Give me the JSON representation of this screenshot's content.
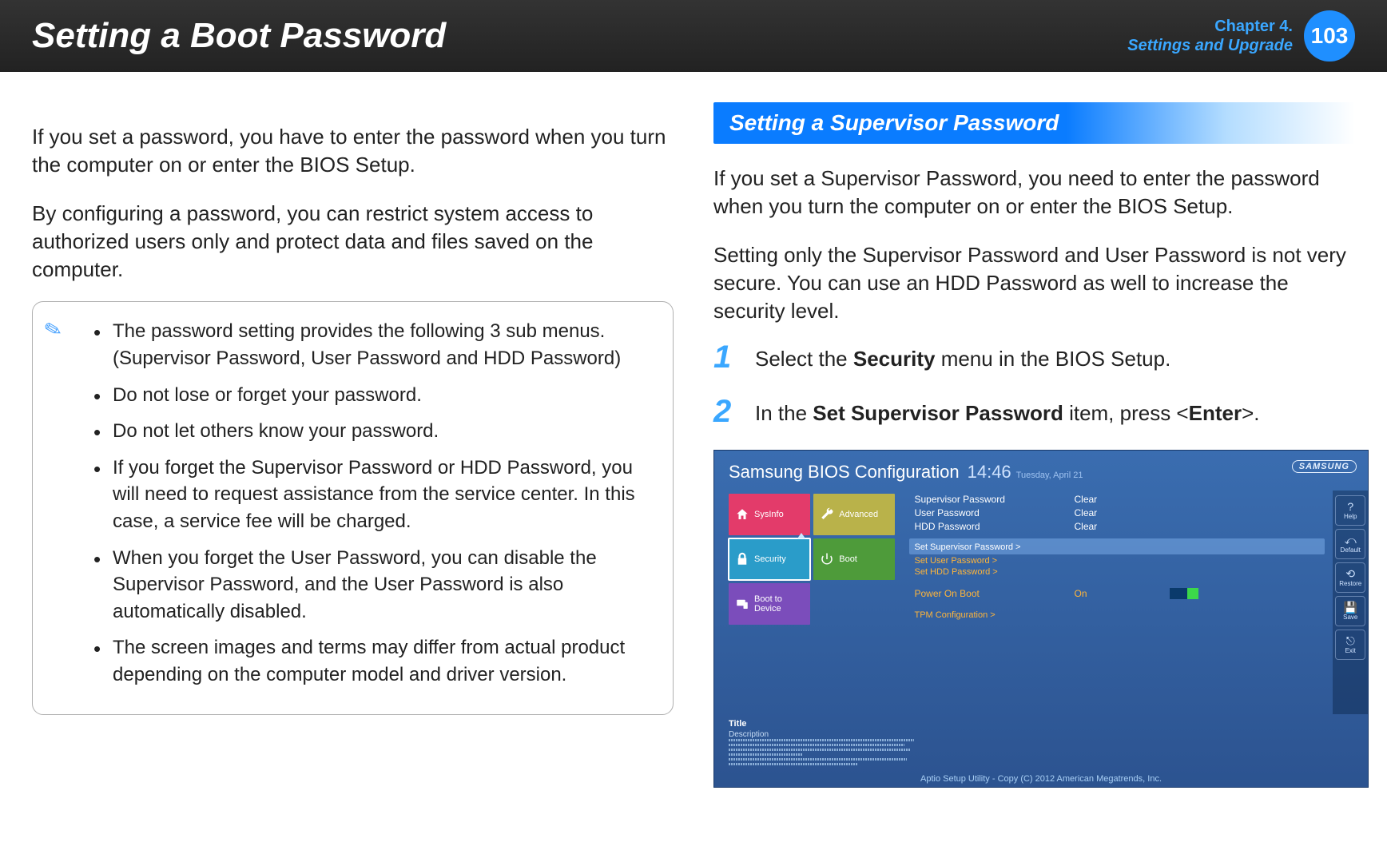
{
  "header": {
    "title": "Setting a Boot Password",
    "chapter_line1": "Chapter 4.",
    "chapter_line2": "Settings and Upgrade",
    "page_number": "103"
  },
  "left": {
    "p1": "If you set a password, you have to enter the password when you turn the computer on or enter the BIOS Setup.",
    "p2": "By configuring a password, you can restrict system access to authorized users only and protect data and files saved on the computer.",
    "notes": [
      "The password setting provides the following 3 sub menus. (Supervisor Password, User Password and HDD Password)",
      "Do not lose or forget your password.",
      "Do not let others know your password.",
      "If you forget the Supervisor Password or HDD Password, you will need to request assistance from the service center. In this case, a service fee will be charged.",
      "When you forget the User Password, you can disable the Supervisor Password, and the User Password is also automatically disabled.",
      "The screen images and terms may differ from actual product depending on the computer model and driver version."
    ]
  },
  "right": {
    "section_title": "Setting a Supervisor Password",
    "p1": "If you set a Supervisor Password, you need to enter the password when you turn the computer on or enter the BIOS Setup.",
    "p2": "Setting only the Supervisor Password and User Password is not very secure. You can use an HDD Password as well to increase the security level.",
    "steps": [
      {
        "num": "1",
        "pre": "Select the ",
        "bold": "Security",
        "post": " menu in the BIOS Setup."
      },
      {
        "num": "2",
        "pre": "In the ",
        "bold": "Set Supervisor Password",
        "post": " item, press <",
        "bold2": "Enter",
        "post2": ">."
      }
    ]
  },
  "bios": {
    "title": "Samsung BIOS Configuration",
    "time": "14:46",
    "date": "Tuesday, April 21",
    "logo": "SAMSUNG",
    "tiles": {
      "sysinfo": "SysInfo",
      "advanced": "Advanced",
      "security": "Security",
      "boot": "Boot",
      "boot_to_device": "Boot to Device"
    },
    "status": [
      {
        "label": "Supervisor Password",
        "value": "Clear"
      },
      {
        "label": "User Password",
        "value": "Clear"
      },
      {
        "label": "HDD Password",
        "value": "Clear"
      }
    ],
    "links": {
      "set_supervisor": "Set Supervisor Password >",
      "set_user": "Set User Password >",
      "set_hdd": "Set HDD Password >",
      "tpm": "TPM Configuration >"
    },
    "power": {
      "label": "Power On Boot",
      "value": "On"
    },
    "sidebar": [
      {
        "glyph": "?",
        "label": "Help"
      },
      {
        "glyph": "⤺",
        "label": "Default"
      },
      {
        "glyph": "⟲",
        "label": "Restore"
      },
      {
        "glyph": "💾",
        "label": "Save"
      },
      {
        "glyph": "⎋",
        "label": "Exit"
      }
    ],
    "desc": {
      "title": "Title",
      "label": "Description"
    },
    "footer": "Aptio Setup Utility - Copy (C) 2012 American Megatrends, Inc."
  }
}
